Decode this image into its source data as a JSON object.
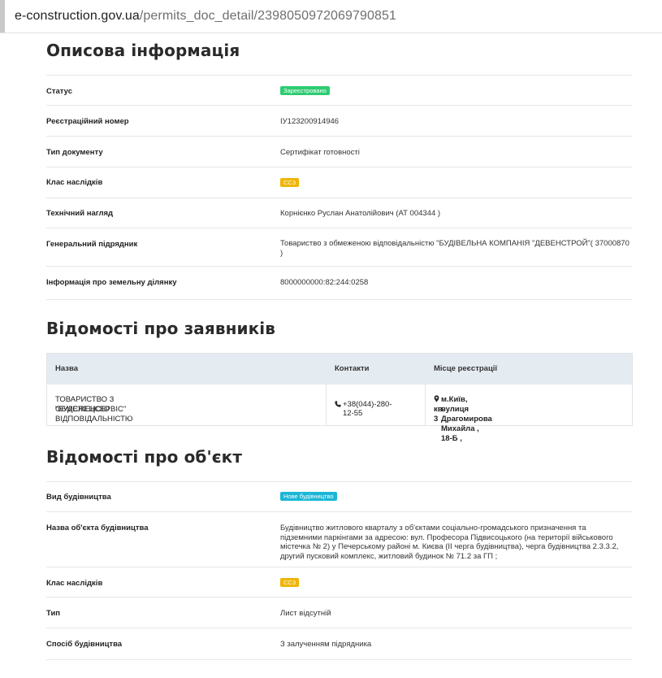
{
  "browser": {
    "url_host": "e-construction.gov.ua",
    "url_path": "/permits_doc_detail/2398050972069790851"
  },
  "descriptive": {
    "title": "Описова інформація",
    "rows": [
      {
        "label": "Статус",
        "value": "Зареєстровано",
        "kind": "badge-green"
      },
      {
        "label": "Реєстраційний номер",
        "value": "ІУ123200914946",
        "kind": "text"
      },
      {
        "label": "Тип документу",
        "value": "Сертифікат готовності",
        "kind": "text"
      },
      {
        "label": "Клас наслідків",
        "value": "СС3",
        "kind": "badge-yellow"
      },
      {
        "label": "Технічний нагляд",
        "value": "Корнієнко Руслан Анатолійович (АТ 004344 )",
        "kind": "text"
      },
      {
        "label": "Генеральний підрядник",
        "value": "Товариство з обмеженою відповідальністю \"БУДІВЕЛЬНА КОМПАНІЯ \"ДЕВЕНСТРОЙ\"( 37000870 )",
        "kind": "text"
      },
      {
        "label": "Інформація про земельну ділянку",
        "value": "8000000000:82:244:0258",
        "kind": "text"
      }
    ]
  },
  "applicants": {
    "title": "Відомості про заявників",
    "columns": [
      "Назва",
      "Контакти",
      "Місце реєстрації"
    ],
    "row": {
      "name_line1": "ТОВАРИСТВО З ОБМЕЖЕНОЮ ВІДПОВІДАЛЬНІСТЮ",
      "name_line2": "\"БУДСПЕЦСЕРВІС\"",
      "phone": "+38(044)-280-12-55",
      "address_line1": "м.Київ, вулиця Драгомирова Михайла , 18-Б ,",
      "address_line2": "кв. 3"
    }
  },
  "object": {
    "title": "Відомості про об'єкт",
    "rows": [
      {
        "label": "Вид будівництва",
        "value": "Нове будівництво",
        "kind": "badge-blue"
      },
      {
        "label": "Назва об'єкта будівництва",
        "value": "Будівництво житлового кварталу з об'єктами соціально-громадського призначення та підземними паркінгами за адресою: вул. Професора Підвисоцького (на території військового містечка № 2) у Печерському районі м. Києва (ІІ черга будівництва), черга будівництва 2.3.3.2, другий пусковий комплекс, житловий будинок № 71.2 за ГП ;",
        "kind": "text"
      },
      {
        "label": "Клас наслідків",
        "value": "СС3",
        "kind": "badge-yellow"
      },
      {
        "label": "Тип",
        "value": "Лист відсутній",
        "kind": "text"
      },
      {
        "label": "Спосіб будівництва",
        "value": "З залученням підрядника",
        "kind": "text"
      }
    ]
  }
}
